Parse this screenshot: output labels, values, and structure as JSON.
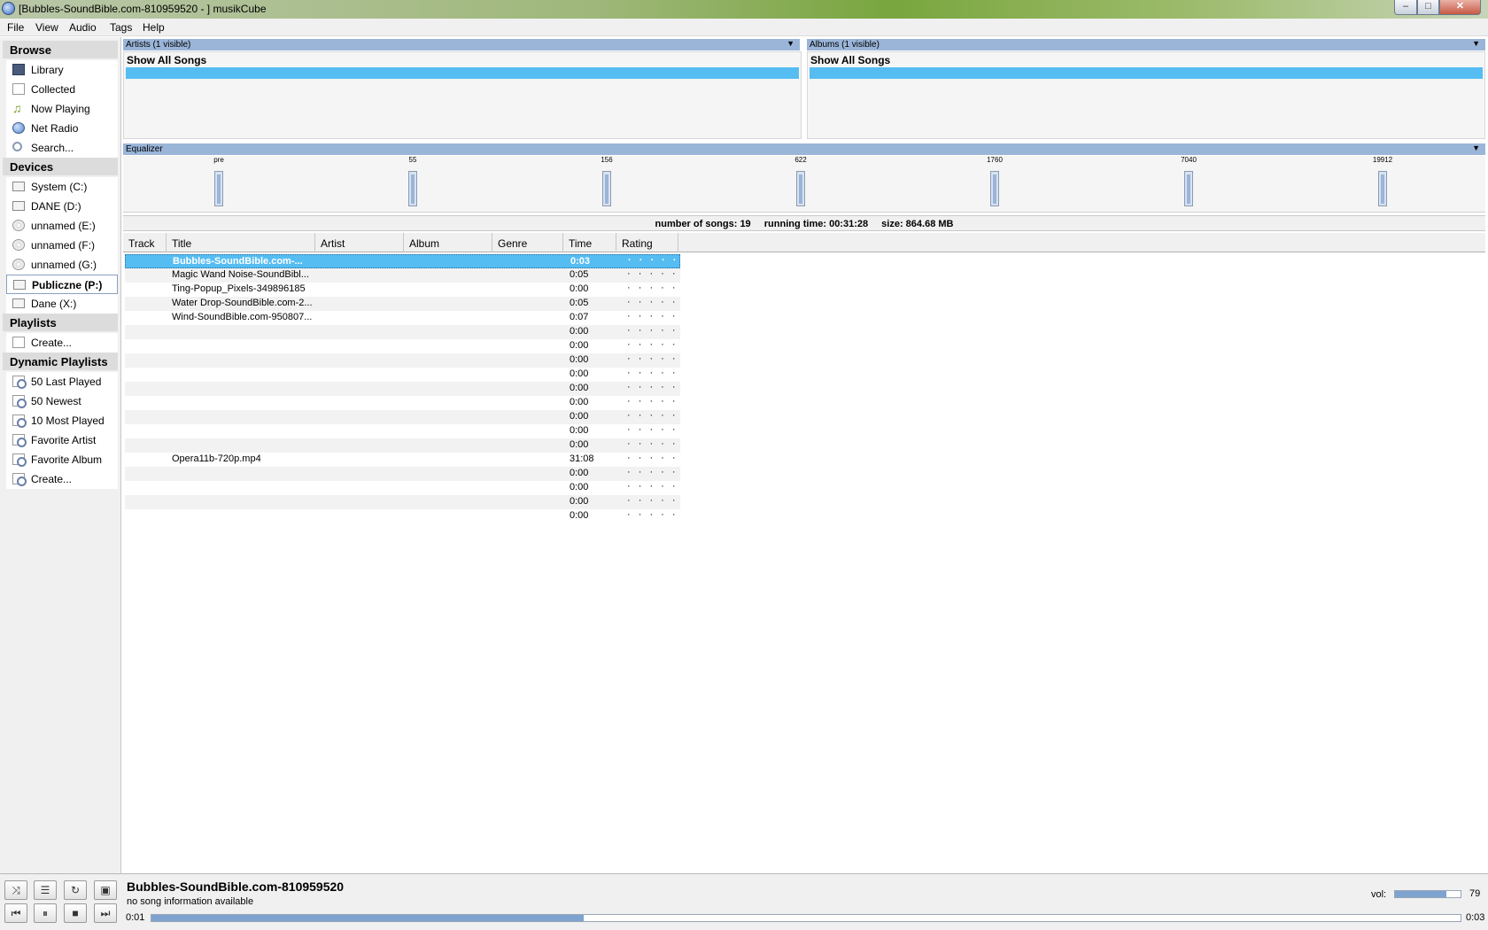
{
  "window": {
    "title": "[Bubbles-SoundBible.com-810959520 - ] musikCube",
    "controls": {
      "minimize": "–",
      "maximize": "□",
      "close": "✕"
    }
  },
  "menu": [
    "File",
    "View",
    "Audio",
    "Tags",
    "Help"
  ],
  "sidebar": {
    "browse_header": "Browse",
    "browse_items": [
      {
        "label": "Library",
        "icon": "library-icon"
      },
      {
        "label": "Collected",
        "icon": "collected-icon"
      },
      {
        "label": "Now Playing",
        "icon": "music-note-icon"
      },
      {
        "label": "Net Radio",
        "icon": "globe-icon"
      },
      {
        "label": "Search...",
        "icon": "search-icon"
      }
    ],
    "devices_header": "Devices",
    "devices": [
      {
        "label": "System (C:)",
        "icon": "drive-icon"
      },
      {
        "label": "DANE (D:)",
        "icon": "drive-icon"
      },
      {
        "label": "unnamed (E:)",
        "icon": "disc-icon"
      },
      {
        "label": "unnamed (F:)",
        "icon": "disc-icon"
      },
      {
        "label": "unnamed (G:)",
        "icon": "disc-icon"
      },
      {
        "label": "Publiczne (P:)",
        "icon": "drive-icon",
        "selected": true
      },
      {
        "label": "Dane (X:)",
        "icon": "drive-icon"
      }
    ],
    "playlists_header": "Playlists",
    "playlists": [
      {
        "label": "Create...",
        "icon": "playlist-icon"
      }
    ],
    "dynamic_header": "Dynamic Playlists",
    "dynamic": [
      {
        "label": "50 Last Played",
        "icon": "dynamic-playlist-icon"
      },
      {
        "label": "50 Newest",
        "icon": "dynamic-playlist-icon"
      },
      {
        "label": "10 Most Played",
        "icon": "dynamic-playlist-icon"
      },
      {
        "label": "Favorite Artist",
        "icon": "dynamic-playlist-icon"
      },
      {
        "label": "Favorite Album",
        "icon": "dynamic-playlist-icon"
      },
      {
        "label": "Create...",
        "icon": "dynamic-playlist-icon"
      }
    ]
  },
  "artists_panel": {
    "header": "Artists (1 visible)",
    "item": "Show All Songs"
  },
  "albums_panel": {
    "header": "Albums (1 visible)",
    "item": "Show All Songs"
  },
  "equalizer": {
    "header": "Equalizer",
    "bands": [
      "pre",
      "55",
      "156",
      "622",
      "1760",
      "7040",
      "19912"
    ]
  },
  "stats": {
    "songs": "number of songs: 19",
    "running_time": "running time: 00:31:28",
    "size": "size: 864.68 MB"
  },
  "table": {
    "columns": [
      "Track",
      "Title",
      "Artist",
      "Album",
      "Genre",
      "Time",
      "Rating"
    ],
    "rating_placeholder": "· · · · ·",
    "rows": [
      {
        "title": "Bubbles-SoundBible.com-...",
        "time": "0:03",
        "selected": true
      },
      {
        "title": "Magic Wand Noise-SoundBibl...",
        "time": "0:05"
      },
      {
        "title": "Ting-Popup_Pixels-349896185",
        "time": "0:00"
      },
      {
        "title": "Water Drop-SoundBible.com-2...",
        "time": "0:05"
      },
      {
        "title": "Wind-SoundBible.com-950807...",
        "time": "0:07"
      },
      {
        "title": "",
        "time": "0:00"
      },
      {
        "title": "",
        "time": "0:00"
      },
      {
        "title": "",
        "time": "0:00"
      },
      {
        "title": "",
        "time": "0:00"
      },
      {
        "title": "",
        "time": "0:00"
      },
      {
        "title": "",
        "time": "0:00"
      },
      {
        "title": "",
        "time": "0:00"
      },
      {
        "title": "",
        "time": "0:00"
      },
      {
        "title": "",
        "time": "0:00"
      },
      {
        "title": "Opera11b-720p.mp4",
        "time": "31:08"
      },
      {
        "title": "",
        "time": "0:00"
      },
      {
        "title": "",
        "time": "0:00"
      },
      {
        "title": "",
        "time": "0:00"
      },
      {
        "title": "",
        "time": "0:00"
      }
    ]
  },
  "player": {
    "title": "Bubbles-SoundBible.com-810959520",
    "info": "no song information available",
    "current_time": "0:01",
    "total_time": "0:03",
    "progress_fraction": 0.33,
    "volume_label": "vol:",
    "volume": 79,
    "buttons": {
      "shuffle": "⤨",
      "equalizer": "☰",
      "repeat": "↻",
      "fullscreen": "▣",
      "prev": "⏮",
      "pause": "⏸",
      "stop": "■",
      "next": "⏭"
    }
  }
}
